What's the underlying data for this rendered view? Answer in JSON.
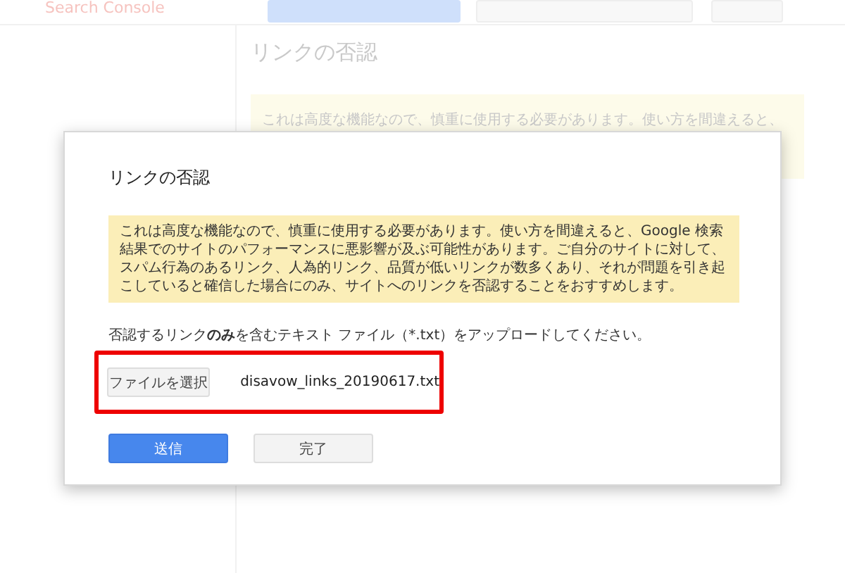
{
  "background": {
    "logo": "Search Console",
    "heading": "リンクの否認",
    "notice_line": "これは高度な機能なので、慎重に使用する必要があります。使い方を間違えると、"
  },
  "dialog": {
    "title": "リンクの否認",
    "warning": "これは高度な機能なので、慎重に使用する必要があります。使い方を間違えると、Google 検索結果でのサイトのパフォーマンスに悪影響が及ぶ可能性があります。ご自分のサイトに対して、スパム行為のあるリンク、人為的リンク、品質が低いリンクが数多くあり、それが問題を引き起こしていると確信した場合にのみ、サイトへのリンクを否認することをおすすめします。",
    "instruction": "否認するリンク**のみ**を含むテキスト ファイル（*.txt）をアップロードしてください。",
    "file_button": "ファイルを選択",
    "file_name": "disavow_links_20190617.txt",
    "buttons": [
      {
        "label": "送信",
        "kind": "primary"
      },
      {
        "label": "完了",
        "kind": "secondary"
      }
    ]
  }
}
